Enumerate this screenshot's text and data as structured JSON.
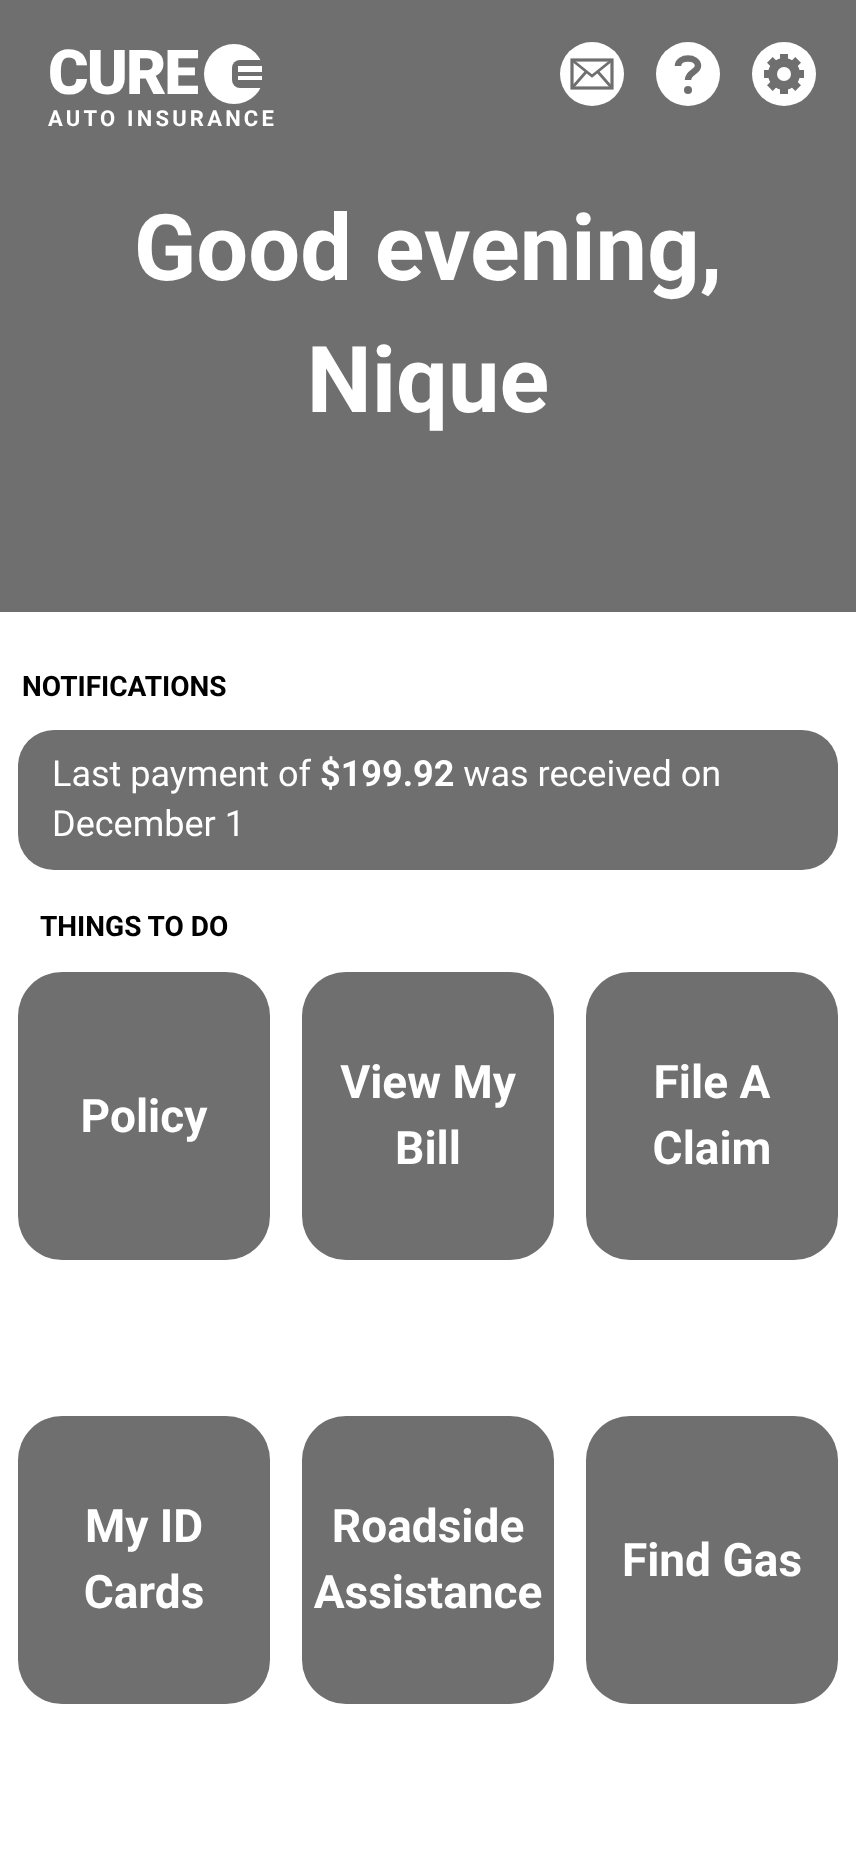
{
  "header": {
    "logo": {
      "brand": "CURE",
      "tagline": "AUTO INSURANCE"
    },
    "actions": [
      {
        "kind": "mail"
      },
      {
        "kind": "help"
      },
      {
        "kind": "settings"
      }
    ],
    "greeting": "Good evening, Nique"
  },
  "notifications": {
    "heading": "NOTIFICATIONS",
    "items": [
      "Last payment of **$199.92** was received on December 1"
    ]
  },
  "things_to_do": {
    "heading": "THINGS TO DO",
    "tiles": [
      {
        "label": "Policy"
      },
      {
        "label": "View My Bill"
      },
      {
        "label": "File A Claim"
      },
      {
        "label": "My ID Cards"
      },
      {
        "label": "Roadside Assistance"
      },
      {
        "label": "Find Gas"
      }
    ]
  }
}
